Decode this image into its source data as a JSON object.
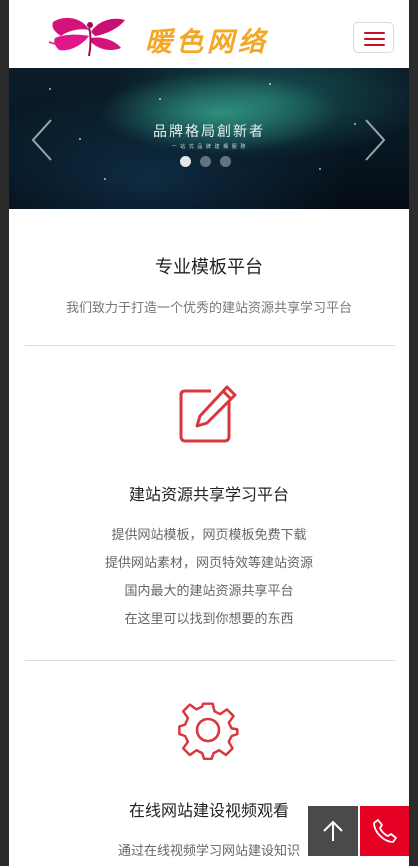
{
  "header": {
    "logo_text": "暖色网络",
    "accent": "#c8102e",
    "logo_color": "#f5a623"
  },
  "banner": {
    "title": "品牌格局創新者",
    "subtitle": "一 站 式 品 牌 建 構 服 務",
    "active_slide": 1,
    "slide_count": 3
  },
  "intro": {
    "heading": "专业模板平台",
    "lead": "我们致力于打造一个优秀的建站资源共享学习平台"
  },
  "features": [
    {
      "icon": "edit-icon",
      "title": "建站资源共享学习平台",
      "lines": [
        "提供网站模板，网页模板免费下载",
        "提供网站素材，网页特效等建站资源",
        "国内最大的建站资源共享平台",
        "在这里可以找到你想要的东西"
      ]
    },
    {
      "icon": "gear-icon",
      "title": "在线网站建设视频观看",
      "lines": [
        "通过在线视频学习网站建设知识"
      ]
    }
  ],
  "colors": {
    "icon_red": "#d9363e",
    "phone_bg": "#e60023",
    "top_bg": "#4a4a4a"
  }
}
